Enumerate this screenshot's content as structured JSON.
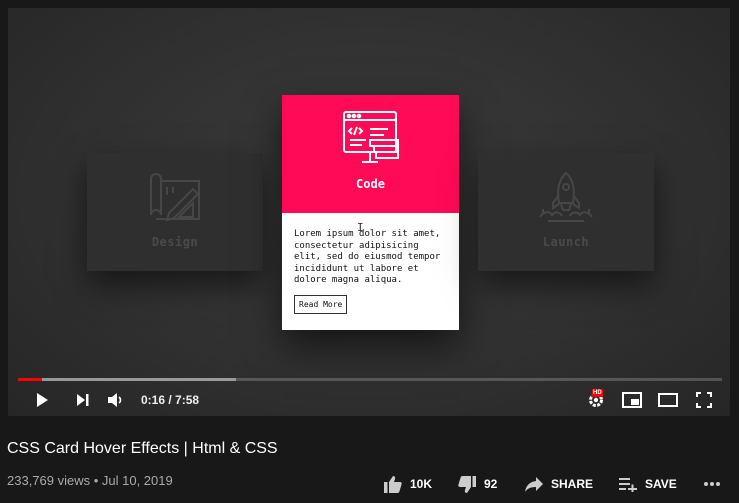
{
  "player": {
    "cards": {
      "design": {
        "title": "Design",
        "icon": "blueprint-pencil-icon"
      },
      "code": {
        "title": "Code",
        "icon": "code-monitor-icon",
        "body": "Lorem ipsum dolor sit amet, consectetur adipisicing elit, sed do eiusmod tempor incididunt ut labore et dolore magna aliqua.",
        "button": "Read More",
        "accent": "#ff0a57"
      },
      "launch": {
        "title": "Launch",
        "icon": "rocket-icon"
      }
    },
    "text_cursor": "I",
    "progress": {
      "played_fraction": 0.034,
      "buffered_fraction": 0.31,
      "played_color": "#ff0000"
    },
    "time": "0:16 / 7:58",
    "hd_badge": "HD"
  },
  "video": {
    "title": "CSS Card Hover Effects | Html & CSS",
    "meta": "233,769 views • Jul 10, 2019",
    "likes": "10K",
    "dislikes": "92",
    "share": "SHARE",
    "save": "SAVE"
  }
}
